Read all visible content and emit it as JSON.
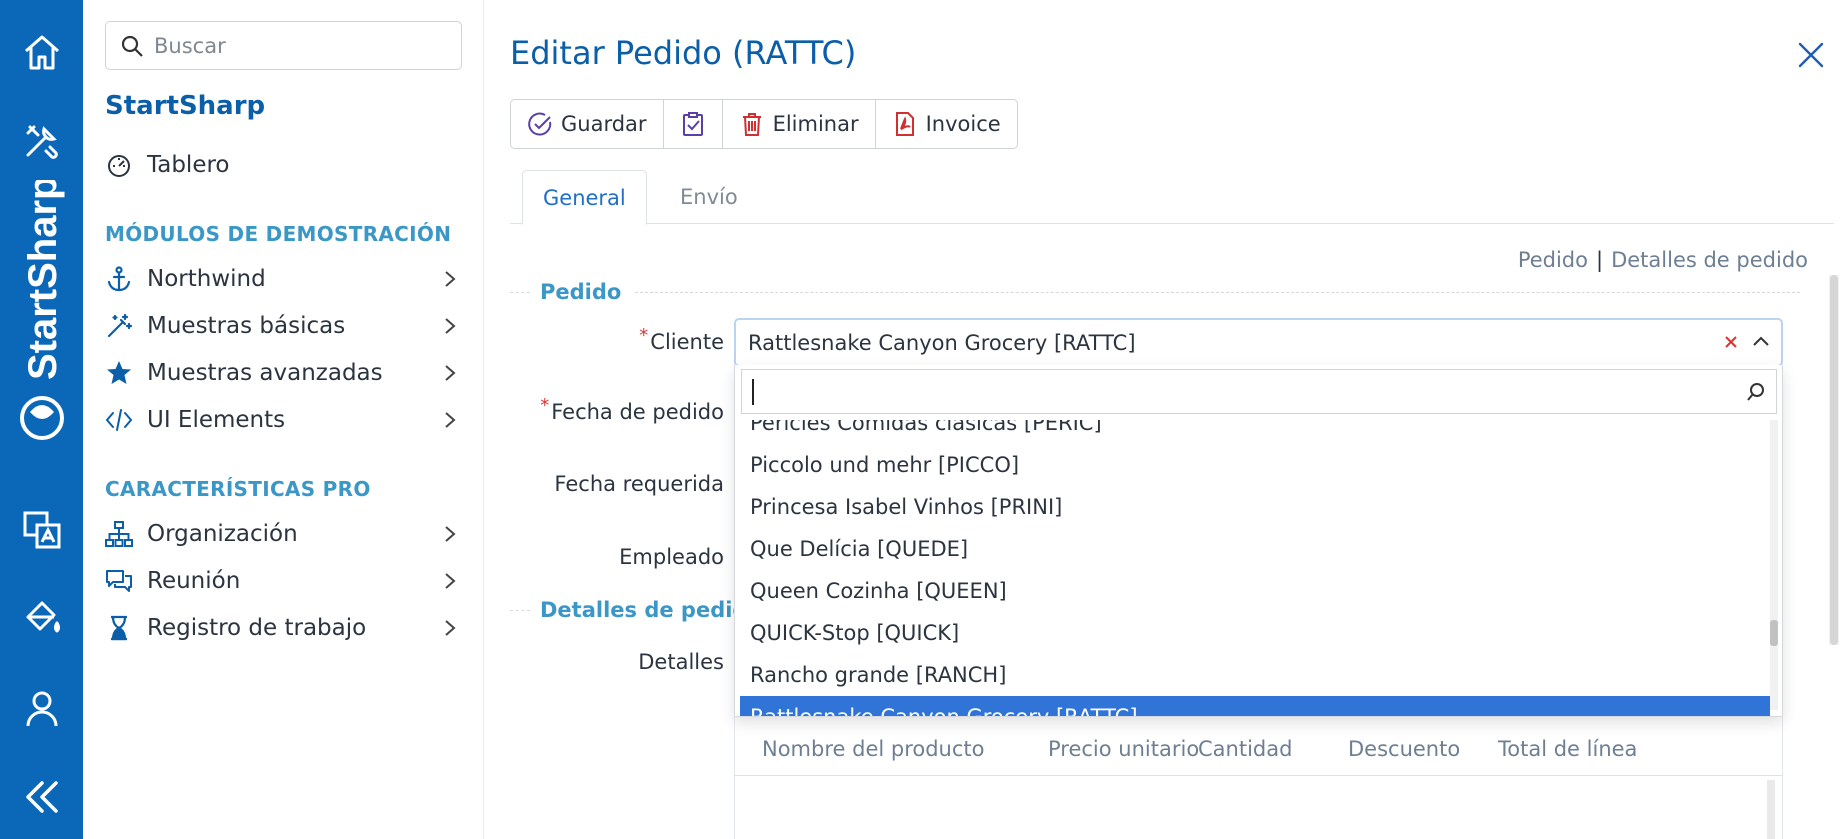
{
  "colors": {
    "rail": "#0b68b8",
    "accent": "#0b5fa8",
    "section": "#3a97c6",
    "selected": "#2f74d6"
  },
  "rail": {
    "brand": "StartSharp",
    "icons": [
      "home-icon",
      "tools-icon",
      "translate-icon",
      "paint-bucket-icon",
      "user-icon",
      "collapse-icon"
    ]
  },
  "sidebar": {
    "search_placeholder": "Buscar",
    "title": "StartSharp",
    "dashboard": "Tablero",
    "section_demo": "MÓDULOS DE DEMOSTRACIÓN",
    "demo_items": [
      {
        "label": "Northwind",
        "icon": "anchor-icon"
      },
      {
        "label": "Muestras básicas",
        "icon": "magic-wand-icon"
      },
      {
        "label": "Muestras avanzadas",
        "icon": "star-icon"
      },
      {
        "label": "UI Elements",
        "icon": "code-icon"
      }
    ],
    "section_pro": "CARACTERÍSTICAS PRO",
    "pro_items": [
      {
        "label": "Organización",
        "icon": "org-chart-icon"
      },
      {
        "label": "Reunión",
        "icon": "chat-icon"
      },
      {
        "label": "Registro de trabajo",
        "icon": "hourglass-icon"
      }
    ]
  },
  "dialog": {
    "title": "Editar Pedido (RATTC)",
    "toolbar": {
      "save": "Guardar",
      "delete": "Eliminar",
      "invoice": "Invoice"
    },
    "tabs": {
      "general": "General",
      "shipping": "Envío"
    },
    "links": {
      "order": "Pedido",
      "sep": "|",
      "details": "Detalles de pedido"
    },
    "categories": {
      "order": "Pedido",
      "details": "Detalles de pedido"
    },
    "labels": {
      "customer": "Cliente",
      "order_date": "Fecha de pedido",
      "required_date": "Fecha requerida",
      "employee": "Empleado",
      "details": "Detalles"
    },
    "required_mark": "*",
    "customer_value": "Rattlesnake Canyon Grocery [RATTC]",
    "dropdown": {
      "search_value": "",
      "items": [
        "Pericles Comidas clásicas [PERIC]",
        "Piccolo und mehr [PICCO]",
        "Princesa Isabel Vinhos [PRINI]",
        "Que Delícia [QUEDE]",
        "Queen Cozinha [QUEEN]",
        "QUICK-Stop [QUICK]",
        "Rancho grande [RANCH]",
        "Rattlesnake Canyon Grocery [RATTC]"
      ],
      "selected_index": 7
    },
    "grid_headers": [
      "Nombre del producto",
      "Precio unitario",
      "Cantidad",
      "Descuento",
      "Total de línea"
    ]
  }
}
